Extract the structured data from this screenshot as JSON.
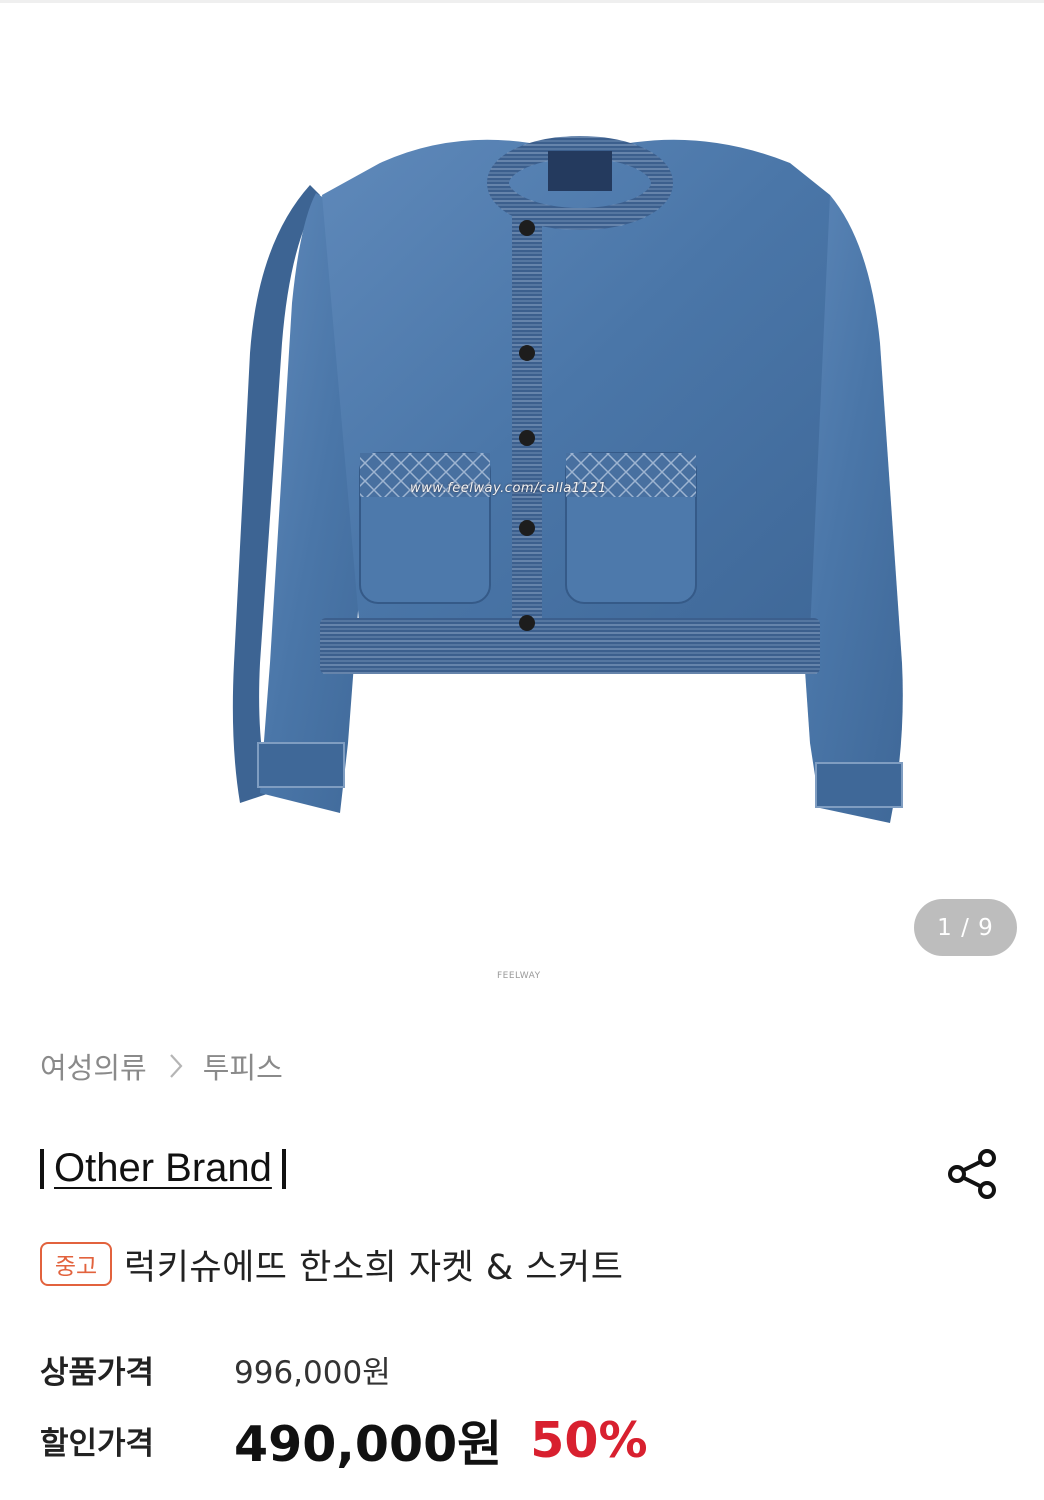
{
  "gallery": {
    "image_alt": "denim jacket",
    "watermark": "www.feelway.com/calla1121",
    "counter": "1 / 9",
    "footer_mark": "FEELWAY"
  },
  "breadcrumb": {
    "items": [
      "여성의류",
      "투피스"
    ]
  },
  "brand": {
    "name": "Other Brand"
  },
  "product": {
    "condition_badge": "중고",
    "title": "럭키슈에뜨 한소희 자켓 & 스커트"
  },
  "price": {
    "original_label": "상품가격",
    "original_value": "996,000원",
    "sale_label": "할인가격",
    "sale_value": "490,000원",
    "discount_rate": "50%"
  },
  "colors": {
    "accent_red": "#d8202f",
    "badge_orange": "#e2623d",
    "denim": "#4a76a8"
  },
  "icons": [
    "share-icon",
    "chevron-right-icon"
  ]
}
